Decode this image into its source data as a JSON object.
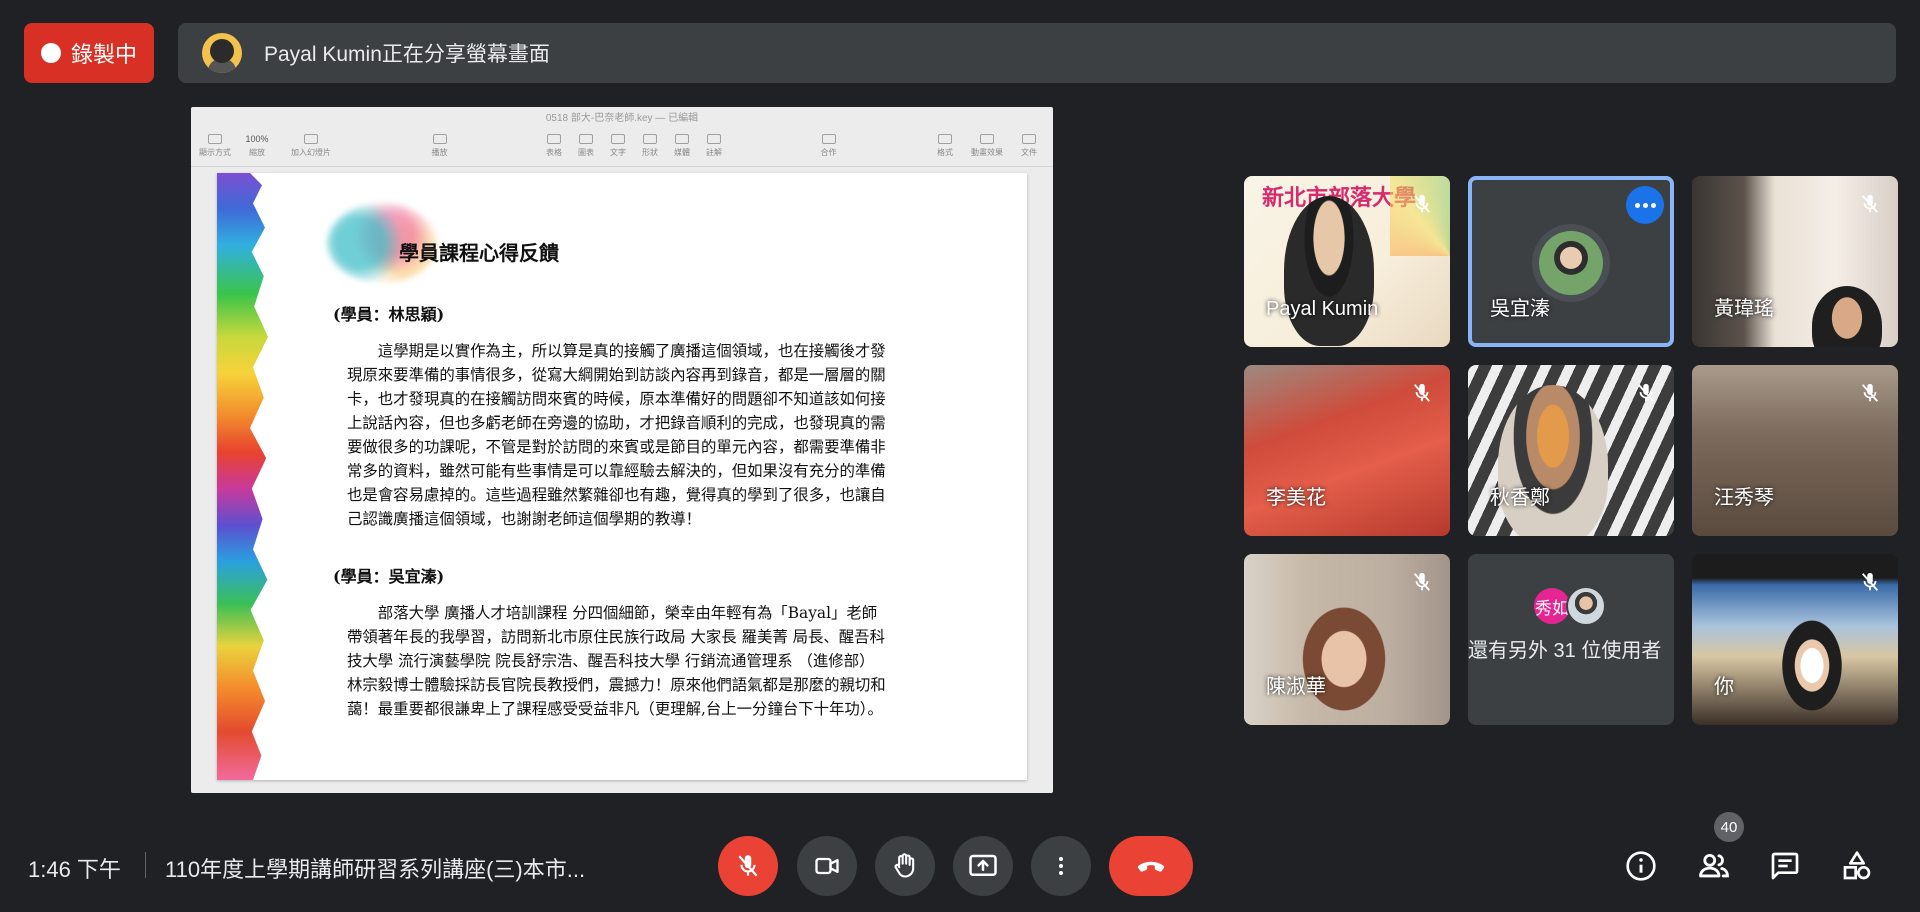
{
  "recording": {
    "label": "錄製中",
    "color": "#d93025"
  },
  "share_banner": {
    "text": "Payal Kumin正在分享螢幕畫面"
  },
  "shared_screen": {
    "window_title": "0518 部大-巴奈老師.key — 已編輯",
    "toolbar": [
      "顯示方式",
      "縮放",
      "加入幻燈片",
      "播放",
      "表格",
      "圖表",
      "文字",
      "形狀",
      "媒體",
      "註解",
      "合作",
      "格式",
      "動畫效果",
      "文件"
    ],
    "zoom": "100%",
    "slide": {
      "heading": "學員課程心得反饋",
      "student1_label": "(學員：林思穎)",
      "student1_text": "這學期是以實作為主，所以算是真的接觸了廣播這個領域，也在接觸後才發現原來要準備的事情很多，從寫大綱開始到訪談內容再到錄音，都是一層層的關卡，也才發現真的在接觸訪問來賓的時候，原本準備好的問題卻不知道該如何接上說話內容，但也多虧老師在旁邊的協助，才把錄音順利的完成，也發現真的需要做很多的功課呢，不管是對於訪問的來賓或是節目的單元內容，都需要準備非常多的資料，雖然可能有些事情是可以靠經驗去解決的，但如果沒有充分的準備也是會容易慮掉的。這些過程雖然繁雜卻也有趣，覺得真的學到了很多，也讓自己認識廣播這個領域，也謝謝老師這個學期的教導！",
      "student2_label": "(學員：吳宜溱)",
      "student2_text": "部落大學 廣播人才培訓課程 分四個細節，榮幸由年輕有為「Bayal」老師帶領著年長的我學習，訪問新北市原住民族行政局 大家長 羅美菁 局長、醒吾科技大學 流行演藝學院 院長舒宗浩、醒吾科技大學 行銷流通管理系 （進修部）林宗毅博士體驗採訪長官院長教授們，震撼力！原來他們語氣都是那麼的親切和藹！最重要都很謙卑上了課程感受受益非凡（更理解,台上一分鐘台下十年功）。"
    }
  },
  "participants": [
    {
      "name": "Payal Kumin",
      "muted": true,
      "overlay_text": "新北市部落大學"
    },
    {
      "name": "吳宜溱",
      "muted": false,
      "active": true
    },
    {
      "name": "黃瑋瑤",
      "muted": true
    },
    {
      "name": "李美花",
      "muted": true
    },
    {
      "name": "秋香鄭",
      "muted": true
    },
    {
      "name": "汪秀琴",
      "muted": true
    },
    {
      "name": "陳淑華",
      "muted": true
    },
    {
      "name": "還有另外 31 位使用者",
      "mini_avatar_label": "秀如",
      "muted": false
    },
    {
      "name": "你",
      "muted": true
    }
  ],
  "bottom_bar": {
    "time": "1:46 下午",
    "meeting_title": "110年度上學期講師研習系列講座(三)本市...",
    "participant_count": "40"
  },
  "icons": [
    "record-dot-icon",
    "mic-off-icon",
    "camera-icon",
    "raise-hand-icon",
    "present-icon",
    "more-vert-icon",
    "end-call-icon",
    "info-icon",
    "people-icon",
    "chat-icon",
    "activities-icon"
  ]
}
